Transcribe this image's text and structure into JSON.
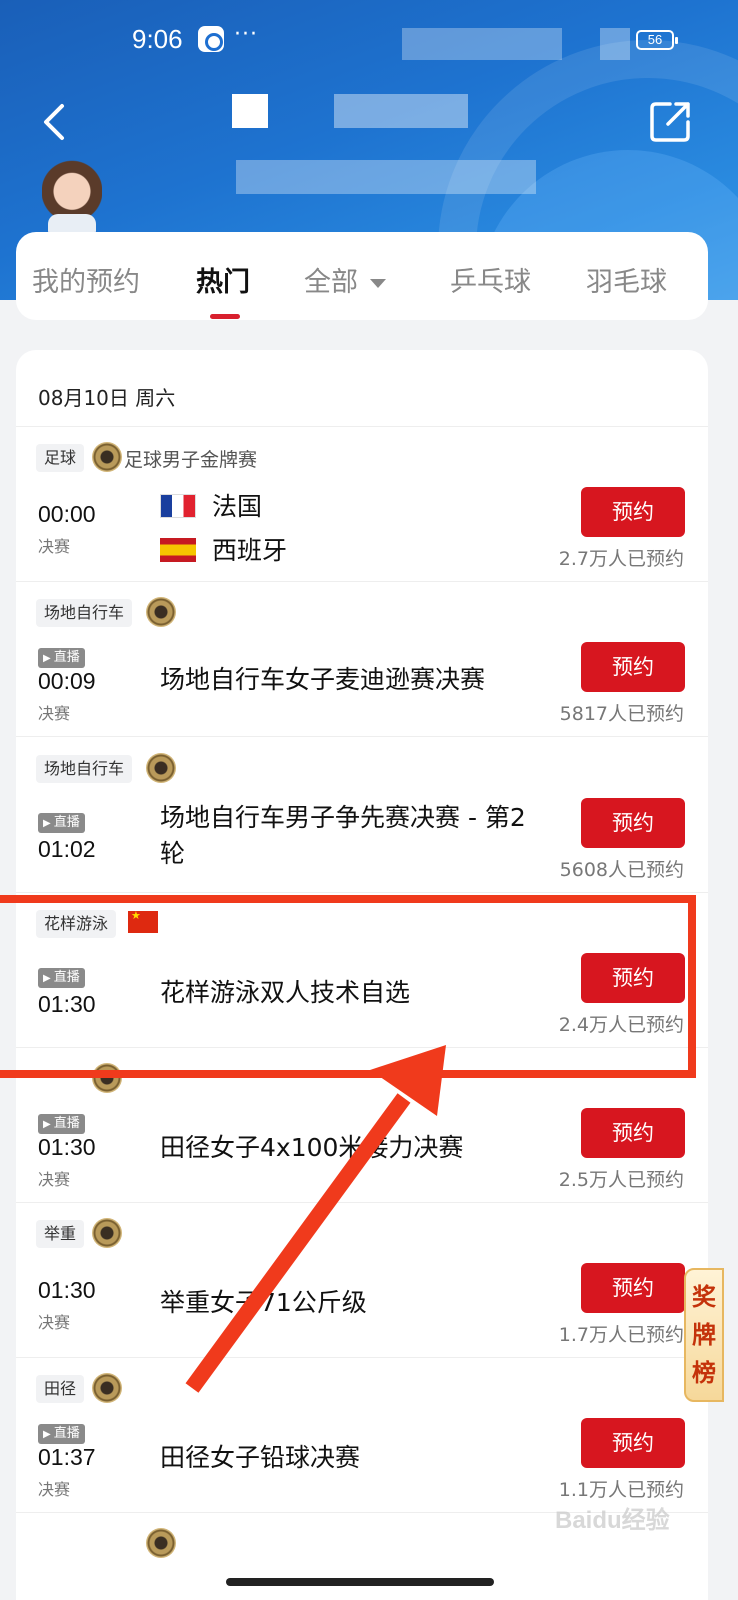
{
  "status_bar": {
    "time": "9:06",
    "battery": "56"
  },
  "tabs": [
    "我的预约",
    "热门",
    "全部",
    "乒乓球",
    "羽毛球"
  ],
  "date_header": "08月10日  周六",
  "events": [
    {
      "sport": "足球",
      "subtitle": "足球男子金牌赛",
      "badge": "gold-medal-icon",
      "live": false,
      "time": "00:00",
      "stage": "决赛",
      "teams": [
        "法国",
        "西班牙"
      ],
      "button": "预约",
      "count": "2.7万人已预约"
    },
    {
      "sport": "场地自行车",
      "badge": "gold-medal-icon",
      "live": true,
      "live_label": "直播",
      "time": "00:09",
      "stage": "决赛",
      "title": "场地自行车女子麦迪逊赛决赛",
      "button": "预约",
      "count": "5817人已预约"
    },
    {
      "sport": "场地自行车",
      "badge": "gold-medal-icon",
      "live": true,
      "live_label": "直播",
      "time": "01:02",
      "title": "场地自行车男子争先赛决赛 - 第2轮",
      "button": "预约",
      "count": "5608人已预约"
    },
    {
      "sport": "花样游泳",
      "badge": "china-flag-icon",
      "live": true,
      "live_label": "直播",
      "time": "01:30",
      "title": "花样游泳双人技术自选",
      "button": "预约",
      "count": "2.4万人已预约"
    },
    {
      "sport": "",
      "badge": "gold-medal-icon",
      "live": true,
      "live_label": "直播",
      "time": "01:30",
      "stage": "决赛",
      "title": "田径女子4x100米接力决赛",
      "button": "预约",
      "count": "2.5万人已预约"
    },
    {
      "sport": "举重",
      "badge": "gold-medal-icon",
      "live": false,
      "time": "01:30",
      "stage": "决赛",
      "title": "举重女子71公斤级",
      "button": "预约",
      "count": "1.7万人已预约"
    },
    {
      "sport": "田径",
      "badge": "gold-medal-icon",
      "live": true,
      "live_label": "直播",
      "time": "01:37",
      "stage": "决赛",
      "title": "田径女子铅球决赛",
      "button": "预约",
      "count": "1.1万人已预约"
    }
  ],
  "medal_rank_label": "奖牌榜",
  "watermark": "Baidu经验",
  "colors": {
    "primary_red": "#d7161f",
    "header_blue": "#1e73d0",
    "highlight": "#f03a1c"
  }
}
